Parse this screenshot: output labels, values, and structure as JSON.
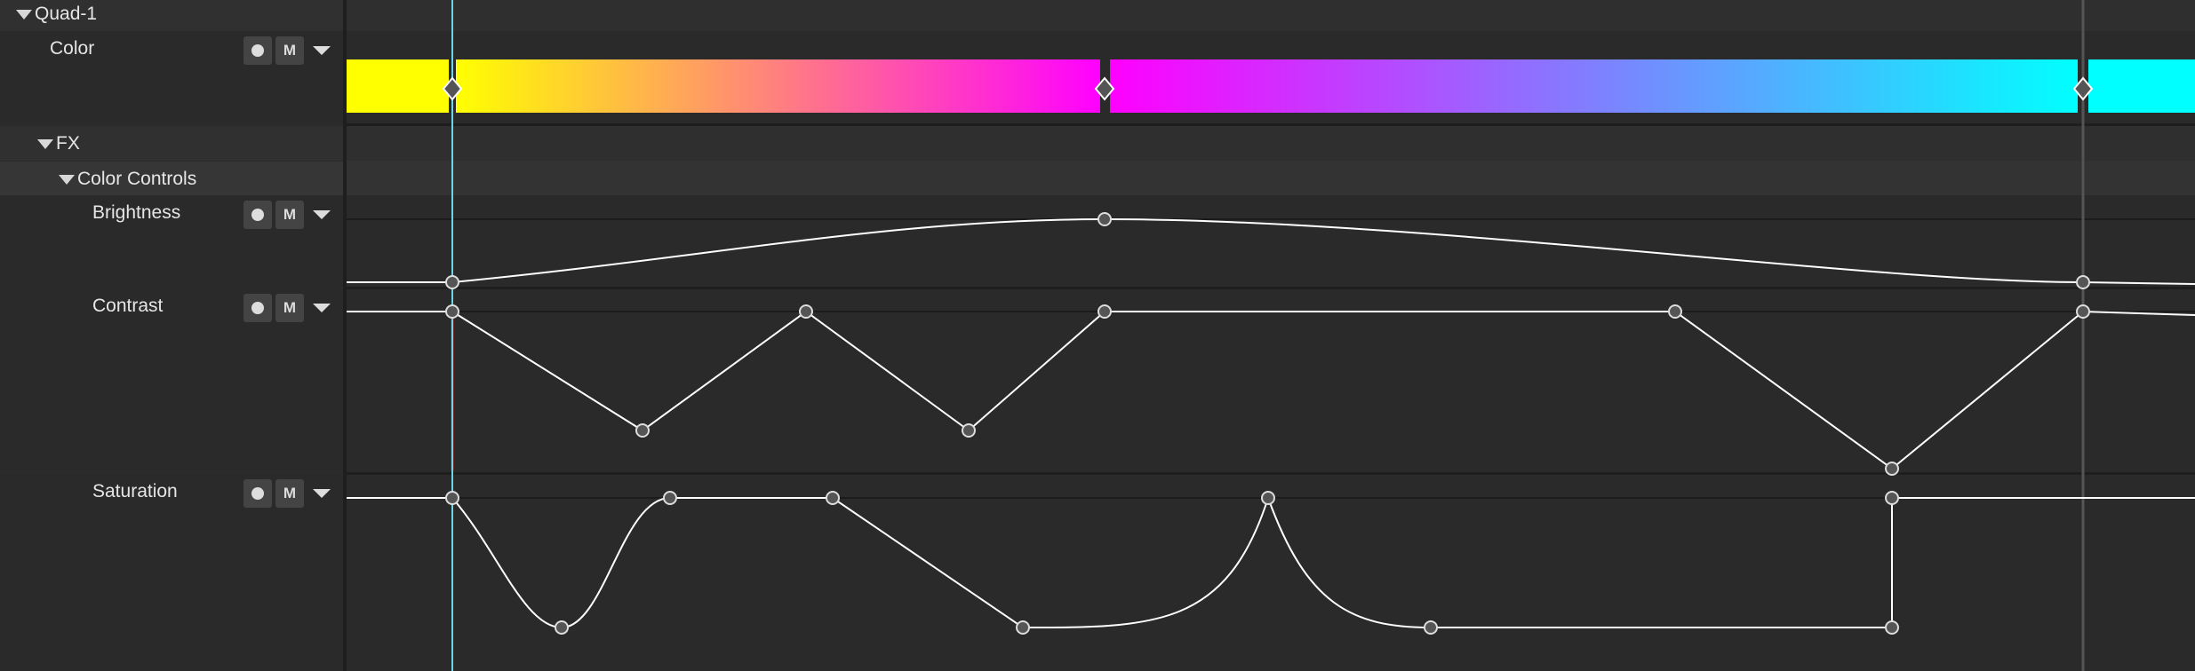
{
  "tracks": {
    "quad": {
      "label": "Quad-1"
    },
    "color": {
      "label": "Color",
      "record_icon": "record-dot-icon",
      "mute_label": "M"
    },
    "fx": {
      "label": "FX"
    },
    "color_controls": {
      "label": "Color Controls"
    },
    "brightness": {
      "label": "Brightness",
      "mute_label": "M"
    },
    "contrast": {
      "label": "Contrast",
      "mute_label": "M"
    },
    "saturation": {
      "label": "Saturation",
      "mute_label": "M"
    }
  },
  "colors": {
    "gradient_stops": [
      "#ffff00",
      "#ff00ff",
      "#00ffff"
    ],
    "playhead": "#6fd3e8",
    "curve": "#ffffff",
    "contrast_marker": "#b02020"
  }
}
